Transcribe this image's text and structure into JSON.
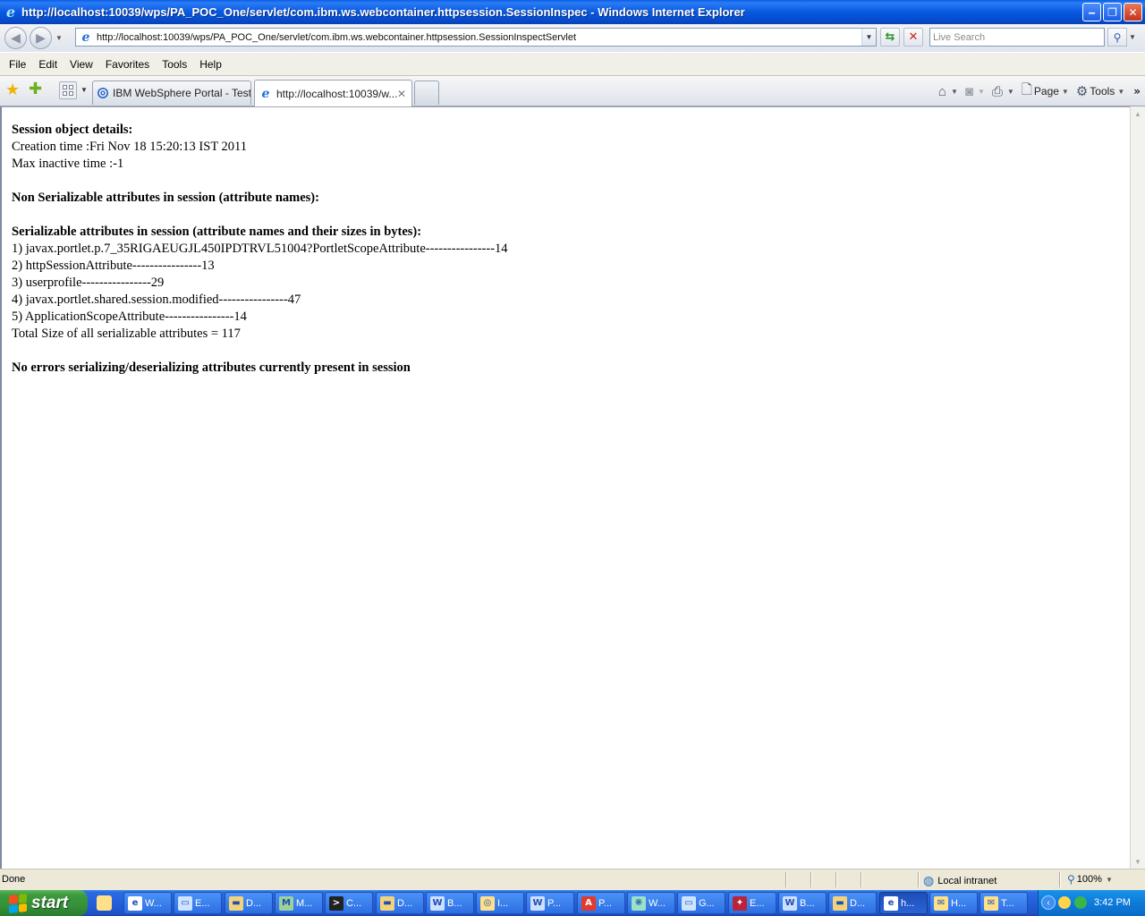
{
  "window": {
    "title": "http://localhost:10039/wps/PA_POC_One/servlet/com.ibm.ws.webcontainer.httpsession.SessionInspec - Windows Internet Explorer",
    "minimize": "‒",
    "restore": "❐",
    "close": "✕"
  },
  "address": {
    "url": "http://localhost:10039/wps/PA_POC_One/servlet/com.ibm.ws.webcontainer.httpsession.SessionInspectServlet",
    "search_placeholder": "Live Search"
  },
  "menu": [
    "File",
    "Edit",
    "View",
    "Favorites",
    "Tools",
    "Help"
  ],
  "tabs": [
    {
      "label": "IBM WebSphere Portal - Test"
    },
    {
      "label": "http://localhost:10039/w..."
    }
  ],
  "commands": {
    "page": "Page",
    "tools": "Tools"
  },
  "content": {
    "heading_details": "Session object details:",
    "creation_time": "Creation time :Fri Nov 18 15:20:13 IST 2011",
    "max_inactive": "Max inactive time :-1",
    "heading_nonserializable": "Non Serializable attributes in session (attribute names):",
    "heading_serializable": "Serializable attributes in session (attribute names and their sizes in bytes):",
    "attributes": [
      "1) javax.portlet.p.7_35RIGAEUGJL450IPDTRVL51004?PortletScopeAttribute----------------14",
      "2) httpSessionAttribute----------------13",
      "3) userprofile----------------29",
      "4) javax.portlet.shared.session.modified----------------47",
      "5) ApplicationScopeAttribute----------------14"
    ],
    "total": "Total Size of all serializable attributes = 117",
    "heading_errors": "No errors serializing/deserializing attributes currently present in session"
  },
  "status": {
    "text": "Done",
    "zone": "Local intranet",
    "zoom": "100%"
  },
  "taskbar": {
    "start": "start",
    "buttons": [
      {
        "label": "W...",
        "color": "#ffffff",
        "glyph": "e"
      },
      {
        "label": "E...",
        "color": "#cfe4ff",
        "glyph": "▭"
      },
      {
        "label": "D...",
        "color": "#f3d27a",
        "glyph": "▬"
      },
      {
        "label": "M...",
        "color": "#9ed09a",
        "glyph": "M"
      },
      {
        "label": "C...",
        "color": "#222222",
        "glyph": ">"
      },
      {
        "label": "D...",
        "color": "#f3d27a",
        "glyph": "▬"
      },
      {
        "label": "B...",
        "color": "#cfe0ff",
        "glyph": "W"
      },
      {
        "label": "I...",
        "color": "#ffe08a",
        "glyph": "◎"
      },
      {
        "label": "P...",
        "color": "#cfe0ff",
        "glyph": "W"
      },
      {
        "label": "P...",
        "color": "#e23b2e",
        "glyph": "A"
      },
      {
        "label": "W...",
        "color": "#9be1c4",
        "glyph": "❋"
      },
      {
        "label": "G...",
        "color": "#cfe4ff",
        "glyph": "▭"
      },
      {
        "label": "E...",
        "color": "#b9243a",
        "glyph": "✦"
      },
      {
        "label": "B...",
        "color": "#cfe0ff",
        "glyph": "W"
      },
      {
        "label": "D...",
        "color": "#f3d27a",
        "glyph": "▬"
      },
      {
        "label": "h...",
        "color": "#ffffff",
        "glyph": "e",
        "active": true
      },
      {
        "label": "H...",
        "color": "#ffe08a",
        "glyph": "✉"
      },
      {
        "label": "T...",
        "color": "#ffe08a",
        "glyph": "✉"
      }
    ],
    "clock": "3:42 PM"
  }
}
